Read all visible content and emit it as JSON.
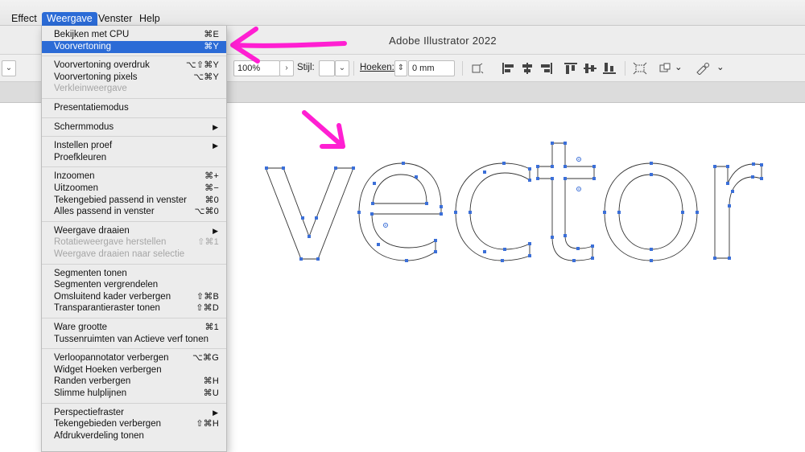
{
  "menubar": {
    "items": [
      {
        "label": "Effect"
      },
      {
        "label": "Weergave"
      },
      {
        "label": "Venster"
      },
      {
        "label": "Help"
      }
    ]
  },
  "window": {
    "title": "Adobe Illustrator 2022"
  },
  "toolbar": {
    "zoom_value": "100%",
    "style_label": "Stijl:",
    "corners_label": "Hoeken:",
    "corners_value": "0 mm"
  },
  "menu": {
    "groups": [
      [
        {
          "label": "Bekijken met CPU",
          "shortcut": "⌘E"
        },
        {
          "label": "Voorvertoning",
          "shortcut": "⌘Y",
          "highlighted": true
        }
      ],
      [
        {
          "label": "Voorvertoning overdruk",
          "shortcut": "⌥⇧⌘Y"
        },
        {
          "label": "Voorvertoning pixels",
          "shortcut": "⌥⌘Y"
        },
        {
          "label": "Verkleinweergave",
          "disabled": true
        }
      ],
      [
        {
          "label": "Presentatiemodus"
        }
      ],
      [
        {
          "label": "Schermmodus",
          "submenu": true
        }
      ],
      [
        {
          "label": "Instellen proef",
          "submenu": true
        },
        {
          "label": "Proefkleuren"
        }
      ],
      [
        {
          "label": "Inzoomen",
          "shortcut": "⌘+"
        },
        {
          "label": "Uitzoomen",
          "shortcut": "⌘−"
        },
        {
          "label": "Tekengebied passend in venster",
          "shortcut": "⌘0"
        },
        {
          "label": "Alles passend in venster",
          "shortcut": "⌥⌘0"
        }
      ],
      [
        {
          "label": "Weergave draaien",
          "submenu": true
        },
        {
          "label": "Rotatieweergave herstellen",
          "shortcut": "⇧⌘1",
          "disabled": true
        },
        {
          "label": "Weergave draaien naar selectie",
          "disabled": true
        }
      ],
      [
        {
          "label": "Segmenten tonen"
        },
        {
          "label": "Segmenten vergrendelen"
        },
        {
          "label": "Omsluitend kader verbergen",
          "shortcut": "⇧⌘B"
        },
        {
          "label": "Transparantieraster tonen",
          "shortcut": "⇧⌘D"
        }
      ],
      [
        {
          "label": "Ware grootte",
          "shortcut": "⌘1"
        },
        {
          "label": "Tussenruimten van Actieve verf tonen"
        }
      ],
      [
        {
          "label": "Verloopannotator verbergen",
          "shortcut": "⌥⌘G"
        },
        {
          "label": "Widget Hoeken verbergen"
        },
        {
          "label": "Randen verbergen",
          "shortcut": "⌘H"
        },
        {
          "label": "Slimme hulplijnen",
          "shortcut": "⌘U"
        }
      ],
      [
        {
          "label": "Perspectiefraster",
          "submenu": true
        },
        {
          "label": "Tekengebieden verbergen",
          "shortcut": "⇧⌘H"
        },
        {
          "label": "Afdrukverdeling tonen"
        }
      ]
    ]
  },
  "colors": {
    "menu_highlight": "#2b6bd6",
    "annotation": "#ff1fd2",
    "anchor": "#3b6fd8",
    "path": "#333333"
  },
  "icons": [
    "arrow-annotation-icon",
    "chevron-right-icon",
    "chevron-down-icon",
    "stepper-icon",
    "align-icon",
    "transform-icon"
  ]
}
